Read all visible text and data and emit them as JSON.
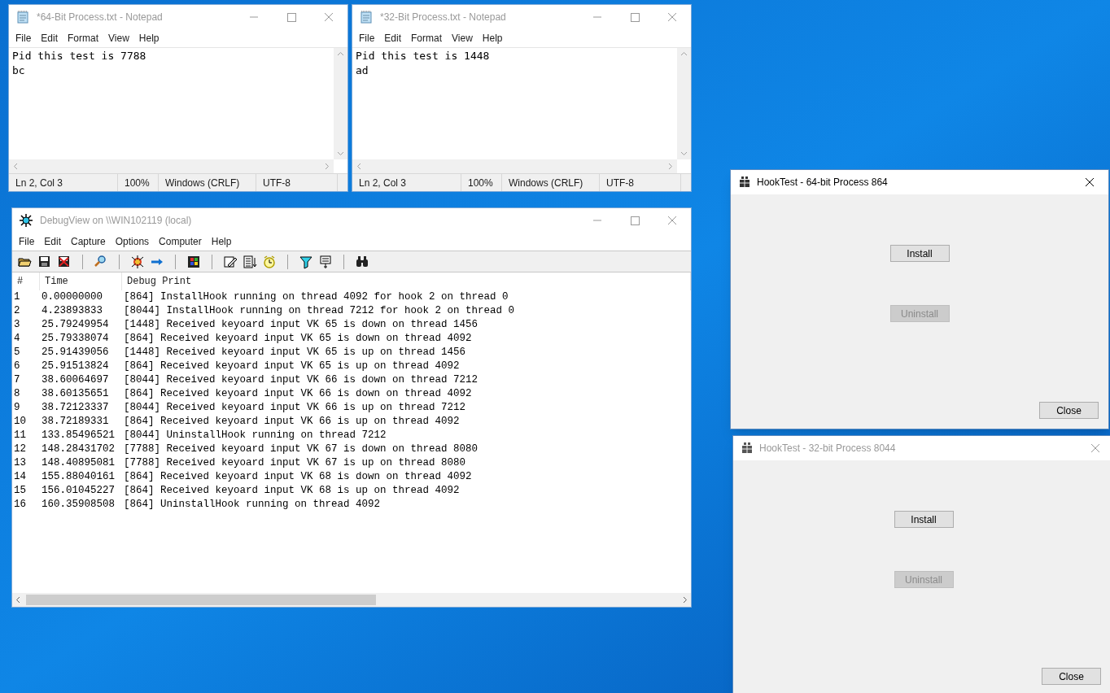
{
  "notepads": [
    {
      "title": "*64-Bit Process.txt - Notepad",
      "active": false,
      "menu": [
        "File",
        "Edit",
        "Format",
        "View",
        "Help"
      ],
      "lines": [
        "Pid this test is 7788",
        "bc"
      ],
      "status": [
        "Ln 2, Col 3",
        "100%",
        "Windows (CRLF)",
        "UTF-8"
      ]
    },
    {
      "title": "*32-Bit Process.txt - Notepad",
      "active": false,
      "menu": [
        "File",
        "Edit",
        "Format",
        "View",
        "Help"
      ],
      "lines": [
        "Pid this test is 1448",
        "ad"
      ],
      "status": [
        "Ln 2, Col 3",
        "100%",
        "Windows (CRLF)",
        "UTF-8"
      ]
    }
  ],
  "debugview": {
    "title": "DebugView on \\\\WIN102119 (local)",
    "active": false,
    "menu": [
      "File",
      "Edit",
      "Capture",
      "Options",
      "Computer",
      "Help"
    ],
    "columns": [
      "#",
      "Time",
      "Debug Print"
    ],
    "rows": [
      {
        "n": "1",
        "time": "0.00000000",
        "text": "[864] InstallHook running on thread 4092 for hook 2 on thread 0"
      },
      {
        "n": "2",
        "time": "4.23893833",
        "text": "[8044] InstallHook running on thread 7212 for hook 2 on thread 0"
      },
      {
        "n": "3",
        "time": "25.79249954",
        "text": "[1448] Received keyoard input VK 65 is down on thread 1456"
      },
      {
        "n": "4",
        "time": "25.79338074",
        "text": "[864] Received keyoard input VK 65 is down on thread 4092"
      },
      {
        "n": "5",
        "time": "25.91439056",
        "text": "[1448] Received keyoard input VK 65 is up on thread 1456"
      },
      {
        "n": "6",
        "time": "25.91513824",
        "text": "[864] Received keyoard input VK 65 is up on thread 4092"
      },
      {
        "n": "7",
        "time": "38.60064697",
        "text": "[8044] Received keyoard input VK 66 is down on thread 7212"
      },
      {
        "n": "8",
        "time": "38.60135651",
        "text": "[864] Received keyoard input VK 66 is down on thread 4092"
      },
      {
        "n": "9",
        "time": "38.72123337",
        "text": "[8044] Received keyoard input VK 66 is up on thread 7212"
      },
      {
        "n": "10",
        "time": "38.72189331",
        "text": "[864] Received keyoard input VK 66 is up on thread 4092"
      },
      {
        "n": "11",
        "time": "133.85496521",
        "text": "[8044] UninstallHook running on thread 7212"
      },
      {
        "n": "12",
        "time": "148.28431702",
        "text": "[7788] Received keyoard input VK 67 is down on thread 8080"
      },
      {
        "n": "13",
        "time": "148.40895081",
        "text": "[7788] Received keyoard input VK 67 is up on thread 8080"
      },
      {
        "n": "14",
        "time": "155.88040161",
        "text": "[864] Received keyoard input VK 68 is down on thread 4092"
      },
      {
        "n": "15",
        "time": "156.01045227",
        "text": "[864] Received keyoard input VK 68 is up on thread 4092"
      },
      {
        "n": "16",
        "time": "160.35908508",
        "text": "[864] UninstallHook running on thread 4092"
      }
    ]
  },
  "hooktests": [
    {
      "title": "HookTest - 64-bit Process 864",
      "active": true,
      "buttons": [
        {
          "label": "Install",
          "disabled": false
        },
        {
          "label": "Uninstall",
          "disabled": true
        }
      ],
      "close_button": "Close"
    },
    {
      "title": "HookTest - 32-bit Process 8044",
      "active": false,
      "buttons": [
        {
          "label": "Install",
          "disabled": false
        },
        {
          "label": "Uninstall",
          "disabled": true
        }
      ],
      "close_button": "Close"
    }
  ]
}
